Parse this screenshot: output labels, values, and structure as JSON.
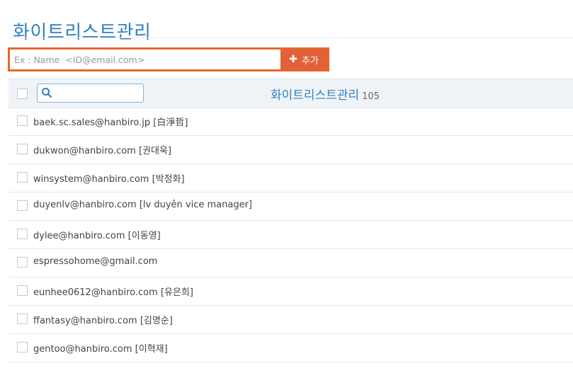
{
  "page": {
    "title": "화이트리스트관리"
  },
  "add_form": {
    "placeholder": "Ex : Name  <ID@email.com>",
    "button_label": "추가"
  },
  "list_header": {
    "title": "화이트리스트관리",
    "count": "105"
  },
  "entries": [
    "baek.sc.sales@hanbiro.jp [白淨哲]",
    "dukwon@hanbiro.com [권대욱]",
    "winsystem@hanbiro.com [박정화]",
    "duyenlv@hanbiro.com [lv duyên vice manager]",
    "dylee@hanbiro.com [이동영]",
    "espressohome@gmail.com",
    "eunhee0612@hanbiro.com [유은희]",
    "ffantasy@hanbiro.com [김명순]",
    "gentoo@hanbiro.com [이혁재]"
  ],
  "colors": {
    "accent": "#2f7fc1",
    "add_button": "#e2603a",
    "add_border": "#e8652a"
  },
  "icons": {
    "search": "search-icon",
    "add": "plus-icon"
  }
}
